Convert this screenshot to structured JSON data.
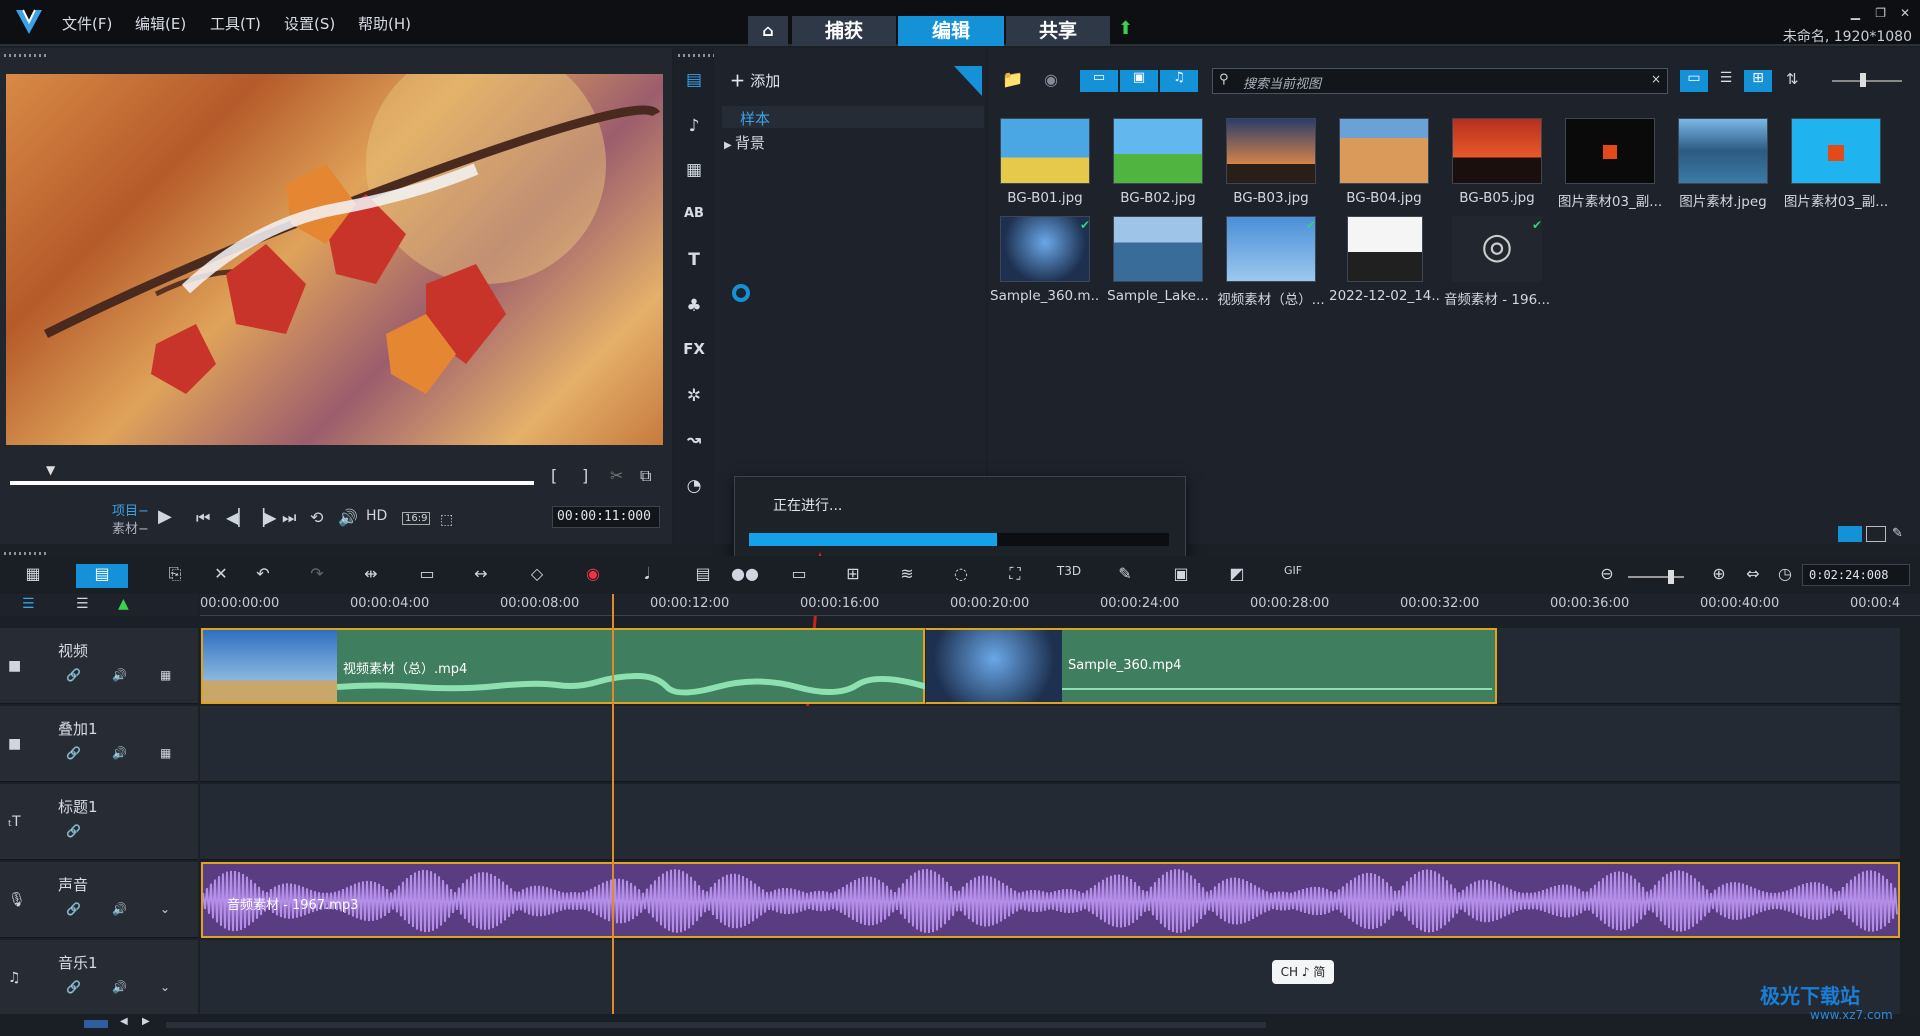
{
  "menu": {
    "file": "文件(F)",
    "edit": "编辑(E)",
    "tools": "工具(T)",
    "settings": "设置(S)",
    "help": "帮助(H)"
  },
  "modes": {
    "capture": "捕获",
    "edit": "编辑",
    "share": "共享"
  },
  "window_info": "未命名, 1920*1080",
  "preview": {
    "project_label": "项目−",
    "clip_label": "素材−",
    "hd": "HD",
    "ratio": "16:9",
    "timecode": "00:00:11:000"
  },
  "library": {
    "add_label": "添加",
    "tree": [
      {
        "label": "样本"
      },
      {
        "label": "背景"
      }
    ],
    "search_placeholder": "搜索当前视图",
    "items": [
      {
        "caption": "BG-B01.jpg"
      },
      {
        "caption": "BG-B02.jpg"
      },
      {
        "caption": "BG-B03.jpg"
      },
      {
        "caption": "BG-B04.jpg"
      },
      {
        "caption": "BG-B05.jpg"
      },
      {
        "caption": "图片素材03_副..."
      },
      {
        "caption": "图片素材.jpeg"
      },
      {
        "caption": "图片素材03_副..."
      },
      {
        "caption": "Sample_360.m..."
      },
      {
        "caption": "Sample_Lake..."
      },
      {
        "caption": "视频素材（总）..."
      },
      {
        "caption": "2022-12-02_14..."
      },
      {
        "caption": "音频素材 - 196..."
      }
    ]
  },
  "dialog": {
    "text": "正在进行...",
    "progress": 0.59
  },
  "timeline": {
    "zoom_timecode": "0:02:24:008",
    "ruler": [
      "00:00:00:00",
      "00:00:04:00",
      "00:00:08:00",
      "00:00:12:00",
      "00:00:16:00",
      "00:00:20:00",
      "00:00:24:00",
      "00:00:28:00",
      "00:00:32:00",
      "00:00:36:00",
      "00:00:40:00",
      "00:00:4"
    ],
    "tracks": [
      {
        "name": "视频"
      },
      {
        "name": "叠加1"
      },
      {
        "name": "标题1"
      },
      {
        "name": "声音"
      },
      {
        "name": "音乐1"
      }
    ],
    "clips": {
      "video1": "视频素材（总）.mp4",
      "video2": "Sample_360.mp4",
      "audio": "音频素材 - 1967.mp3"
    }
  },
  "ime": "CH ♪ 简",
  "watermark": "极光下载站",
  "watermark_url": "www.xz7.com"
}
